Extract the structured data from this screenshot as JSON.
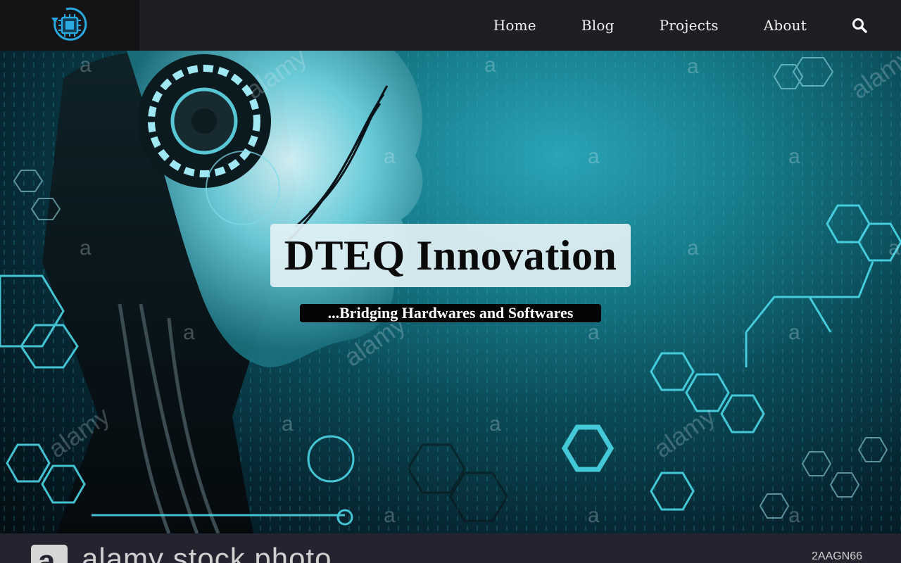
{
  "nav": {
    "links": [
      {
        "label": "Home"
      },
      {
        "label": "Blog"
      },
      {
        "label": "Projects"
      },
      {
        "label": "About"
      }
    ],
    "icons": {
      "logo": "chip-refresh-icon",
      "search": "search-icon"
    }
  },
  "hero": {
    "title": "DTEQ Innovation",
    "subtitle": "...Bridging Hardwares and Softwares"
  },
  "watermark": {
    "brand": "alamy stock photo",
    "logo_letter": "a",
    "image_code": "2AAGN66"
  },
  "colors": {
    "navbar": "#1e1f23",
    "logo_bg": "#141416",
    "accent": "#29a9e0",
    "hero_teal": "#18808f"
  }
}
